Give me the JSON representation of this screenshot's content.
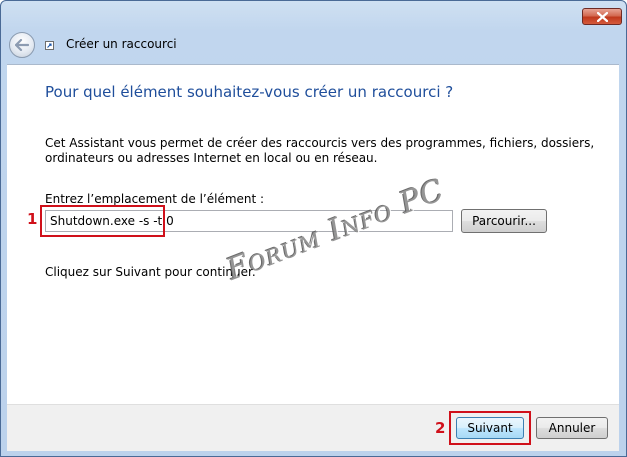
{
  "window": {
    "title": "Créer un raccourci"
  },
  "wizard": {
    "heading": "Pour quel élément souhaitez-vous créer un raccourci ?",
    "description": "Cet Assistant vous permet de créer des raccourcis vers des programmes, fichiers, dossiers, ordinateurs ou adresses Internet en local ou en réseau.",
    "location_label": "Entrez l’emplacement de l’élément :",
    "location_value": "Shutdown.exe -s -t 0",
    "browse_label": "Parcourir...",
    "continue_text": "Cliquez sur Suivant pour continuer."
  },
  "footer": {
    "next_label": "Suivant",
    "cancel_label": "Annuler"
  },
  "annotations": {
    "marker_1": "1",
    "marker_2": "2",
    "highlight_color": "#d0101a"
  },
  "watermark": {
    "text": "Forum Info PC"
  },
  "icons": {
    "close": "close-icon",
    "back": "back-arrow-icon",
    "shortcut": "shortcut-icon"
  },
  "colors": {
    "heading": "#1f4e9b",
    "frame": "#bcd2ec",
    "close_button": "#c0391d"
  }
}
